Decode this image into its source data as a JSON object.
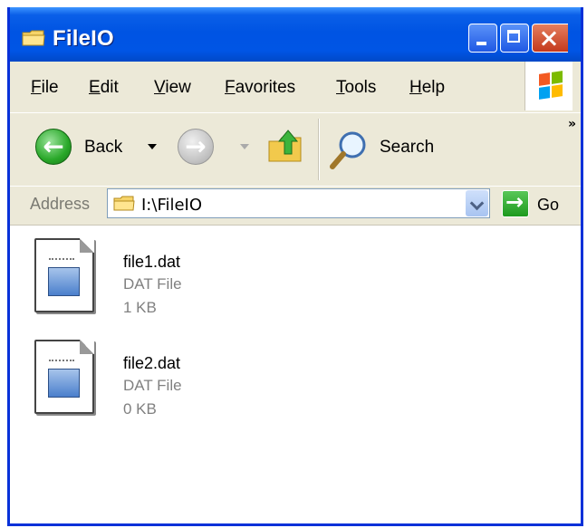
{
  "window": {
    "title": "FileIO",
    "folder_icon": "folder-icon",
    "controls": [
      "minimize-icon",
      "maximize-icon",
      "close-icon"
    ]
  },
  "menu": {
    "items": [
      "File",
      "Edit",
      "View",
      "Favorites",
      "Tools",
      "Help"
    ]
  },
  "toolbar": {
    "back_label": "Back",
    "search_label": "Search",
    "overflow": "»",
    "icons": [
      "back-arrow-icon",
      "forward-arrow-icon",
      "folder-up-icon",
      "search-magnifier-icon"
    ]
  },
  "address": {
    "label": "Address",
    "value": "I:\\FileIO",
    "go_label": "Go"
  },
  "files": [
    {
      "name": "file1.dat",
      "type": "DAT File",
      "size": "1 KB"
    },
    {
      "name": "file2.dat",
      "type": "DAT File",
      "size": "0 KB"
    }
  ],
  "colors": {
    "title_bar": "#0054e3",
    "chrome": "#ece9d8",
    "close_button": "#c4391c"
  }
}
